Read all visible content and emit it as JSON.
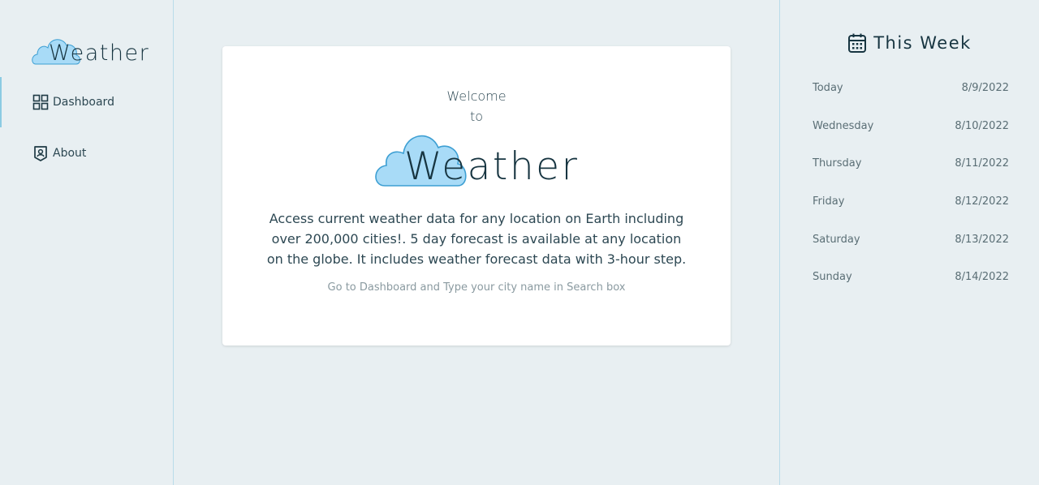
{
  "sidebar": {
    "logo_text": "Weather",
    "items": [
      {
        "label": "Dashboard",
        "icon": "grid-icon",
        "active": true
      },
      {
        "label": "About",
        "icon": "user-badge-icon",
        "active": false
      }
    ]
  },
  "card": {
    "welcome": "Welcome",
    "to": "to",
    "logo_text": "Weather",
    "description": "Access current weather data for any location on Earth including over 200,000 cities!. 5 day forecast is available at any location on the globe. It includes weather forecast data with 3-hour step.",
    "hint": "Go to Dashboard and Type your city name in Search box"
  },
  "week": {
    "title": "This Week",
    "icon": "calendar-icon",
    "days": [
      {
        "day": "Today",
        "date": "8/9/2022"
      },
      {
        "day": "Wednesday",
        "date": "8/10/2022"
      },
      {
        "day": "Thursday",
        "date": "8/11/2022"
      },
      {
        "day": "Friday",
        "date": "8/12/2022"
      },
      {
        "day": "Saturday",
        "date": "8/13/2022"
      },
      {
        "day": "Sunday",
        "date": "8/14/2022"
      }
    ]
  },
  "colors": {
    "background": "#e8eff2",
    "accent": "#8ccbe3",
    "cloud_fill": "#a8dbf7",
    "cloud_stroke": "#3d9fd3",
    "text": "#173541"
  }
}
